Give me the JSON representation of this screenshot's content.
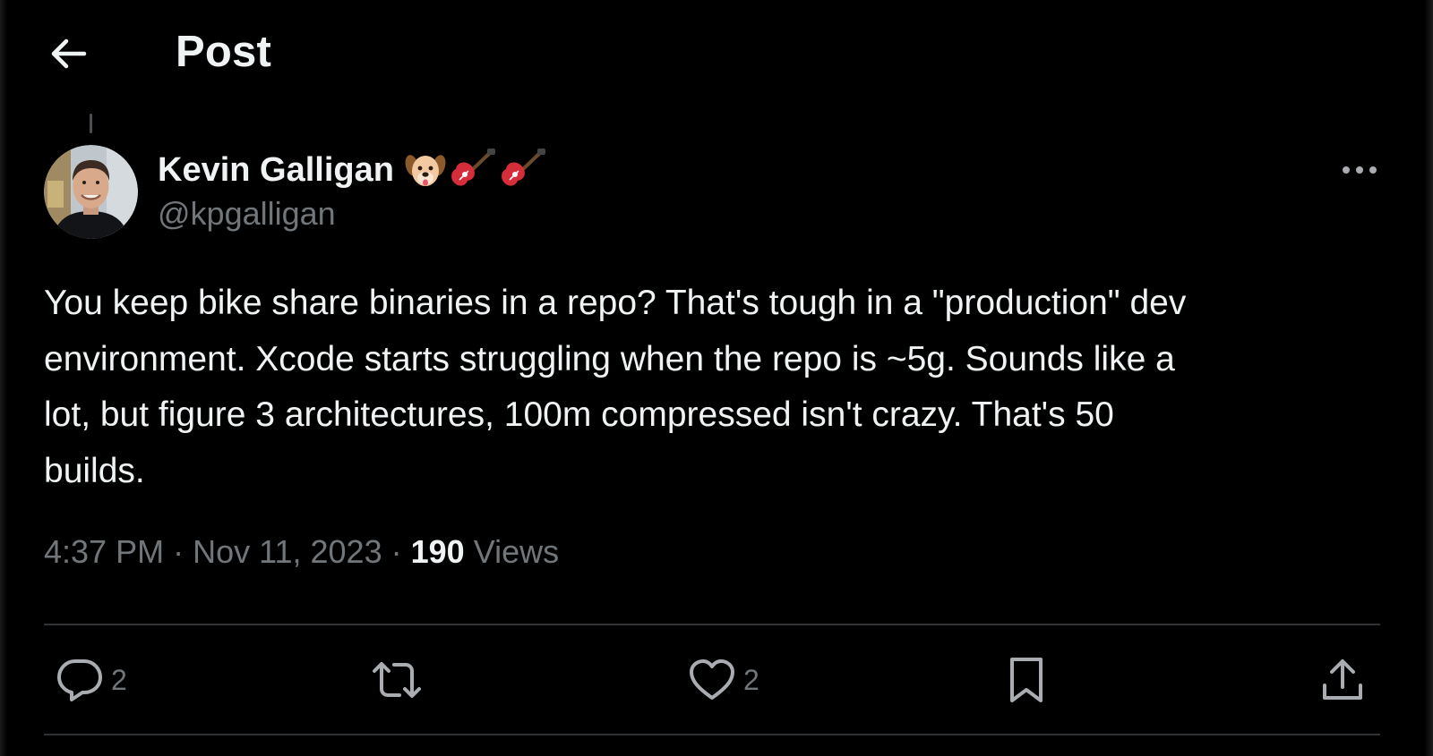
{
  "header": {
    "title": "Post",
    "back_icon": "arrow-left-icon"
  },
  "author": {
    "display_name": "Kevin Galligan",
    "handle": "@kpgalligan",
    "name_emojis": [
      "dog-face-icon",
      "guitar-icon",
      "guitar-icon"
    ]
  },
  "post": {
    "text_lines": [
      "You keep bike share binaries in a repo? That's tough in a \"production\" dev",
      "environment. Xcode starts struggling when the repo is ~5g. Sounds like a",
      "lot, but figure 3 architectures, 100m compressed isn't crazy. That's 50",
      "builds."
    ],
    "time": "4:37 PM",
    "separator": "·",
    "date": "Nov 11, 2023",
    "views_count": "190",
    "views_label": "Views"
  },
  "actions": {
    "reply_count": "2",
    "like_count": "2"
  },
  "colors": {
    "background": "#000000",
    "text_primary": "#eff3f4",
    "text_secondary": "#71767b",
    "divider": "#2f3336"
  }
}
